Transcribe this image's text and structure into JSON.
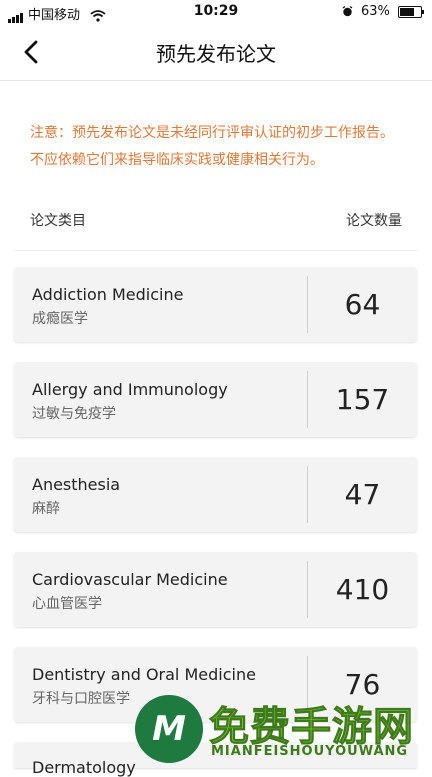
{
  "status_bar": {
    "carrier": "中国移动",
    "time": "10:29",
    "battery_percent": "63%",
    "battery_level": 0.63
  },
  "nav": {
    "title": "预先发布论文"
  },
  "notice": "注意：预先发布论文是未经同行评审认证的初步工作报告。不应依赖它们来指导临床实践或健康相关行为。",
  "list_header": {
    "category": "论文类目",
    "count": "论文数量"
  },
  "categories": [
    {
      "en": "Addiction Medicine",
      "zh": "成瘾医学",
      "count": "64"
    },
    {
      "en": "Allergy and Immunology",
      "zh": "过敏与免疫学",
      "count": "157"
    },
    {
      "en": "Anesthesia",
      "zh": "麻醉",
      "count": "47"
    },
    {
      "en": "Cardiovascular Medicine",
      "zh": "心血管医学",
      "count": "410"
    },
    {
      "en": "Dentistry and Oral Medicine",
      "zh": "牙科与口腔医学",
      "count": "76"
    },
    {
      "en": "Dermatology",
      "zh": "",
      "count": ""
    }
  ],
  "watermark": {
    "logo_letter": "M",
    "title": "免费手游网",
    "subtitle": "MIANFEISHOUYOUWANG"
  },
  "colors": {
    "notice": "#e07a3a",
    "card_bg": "#f3f3f3",
    "watermark_green": "#7cc43a"
  }
}
